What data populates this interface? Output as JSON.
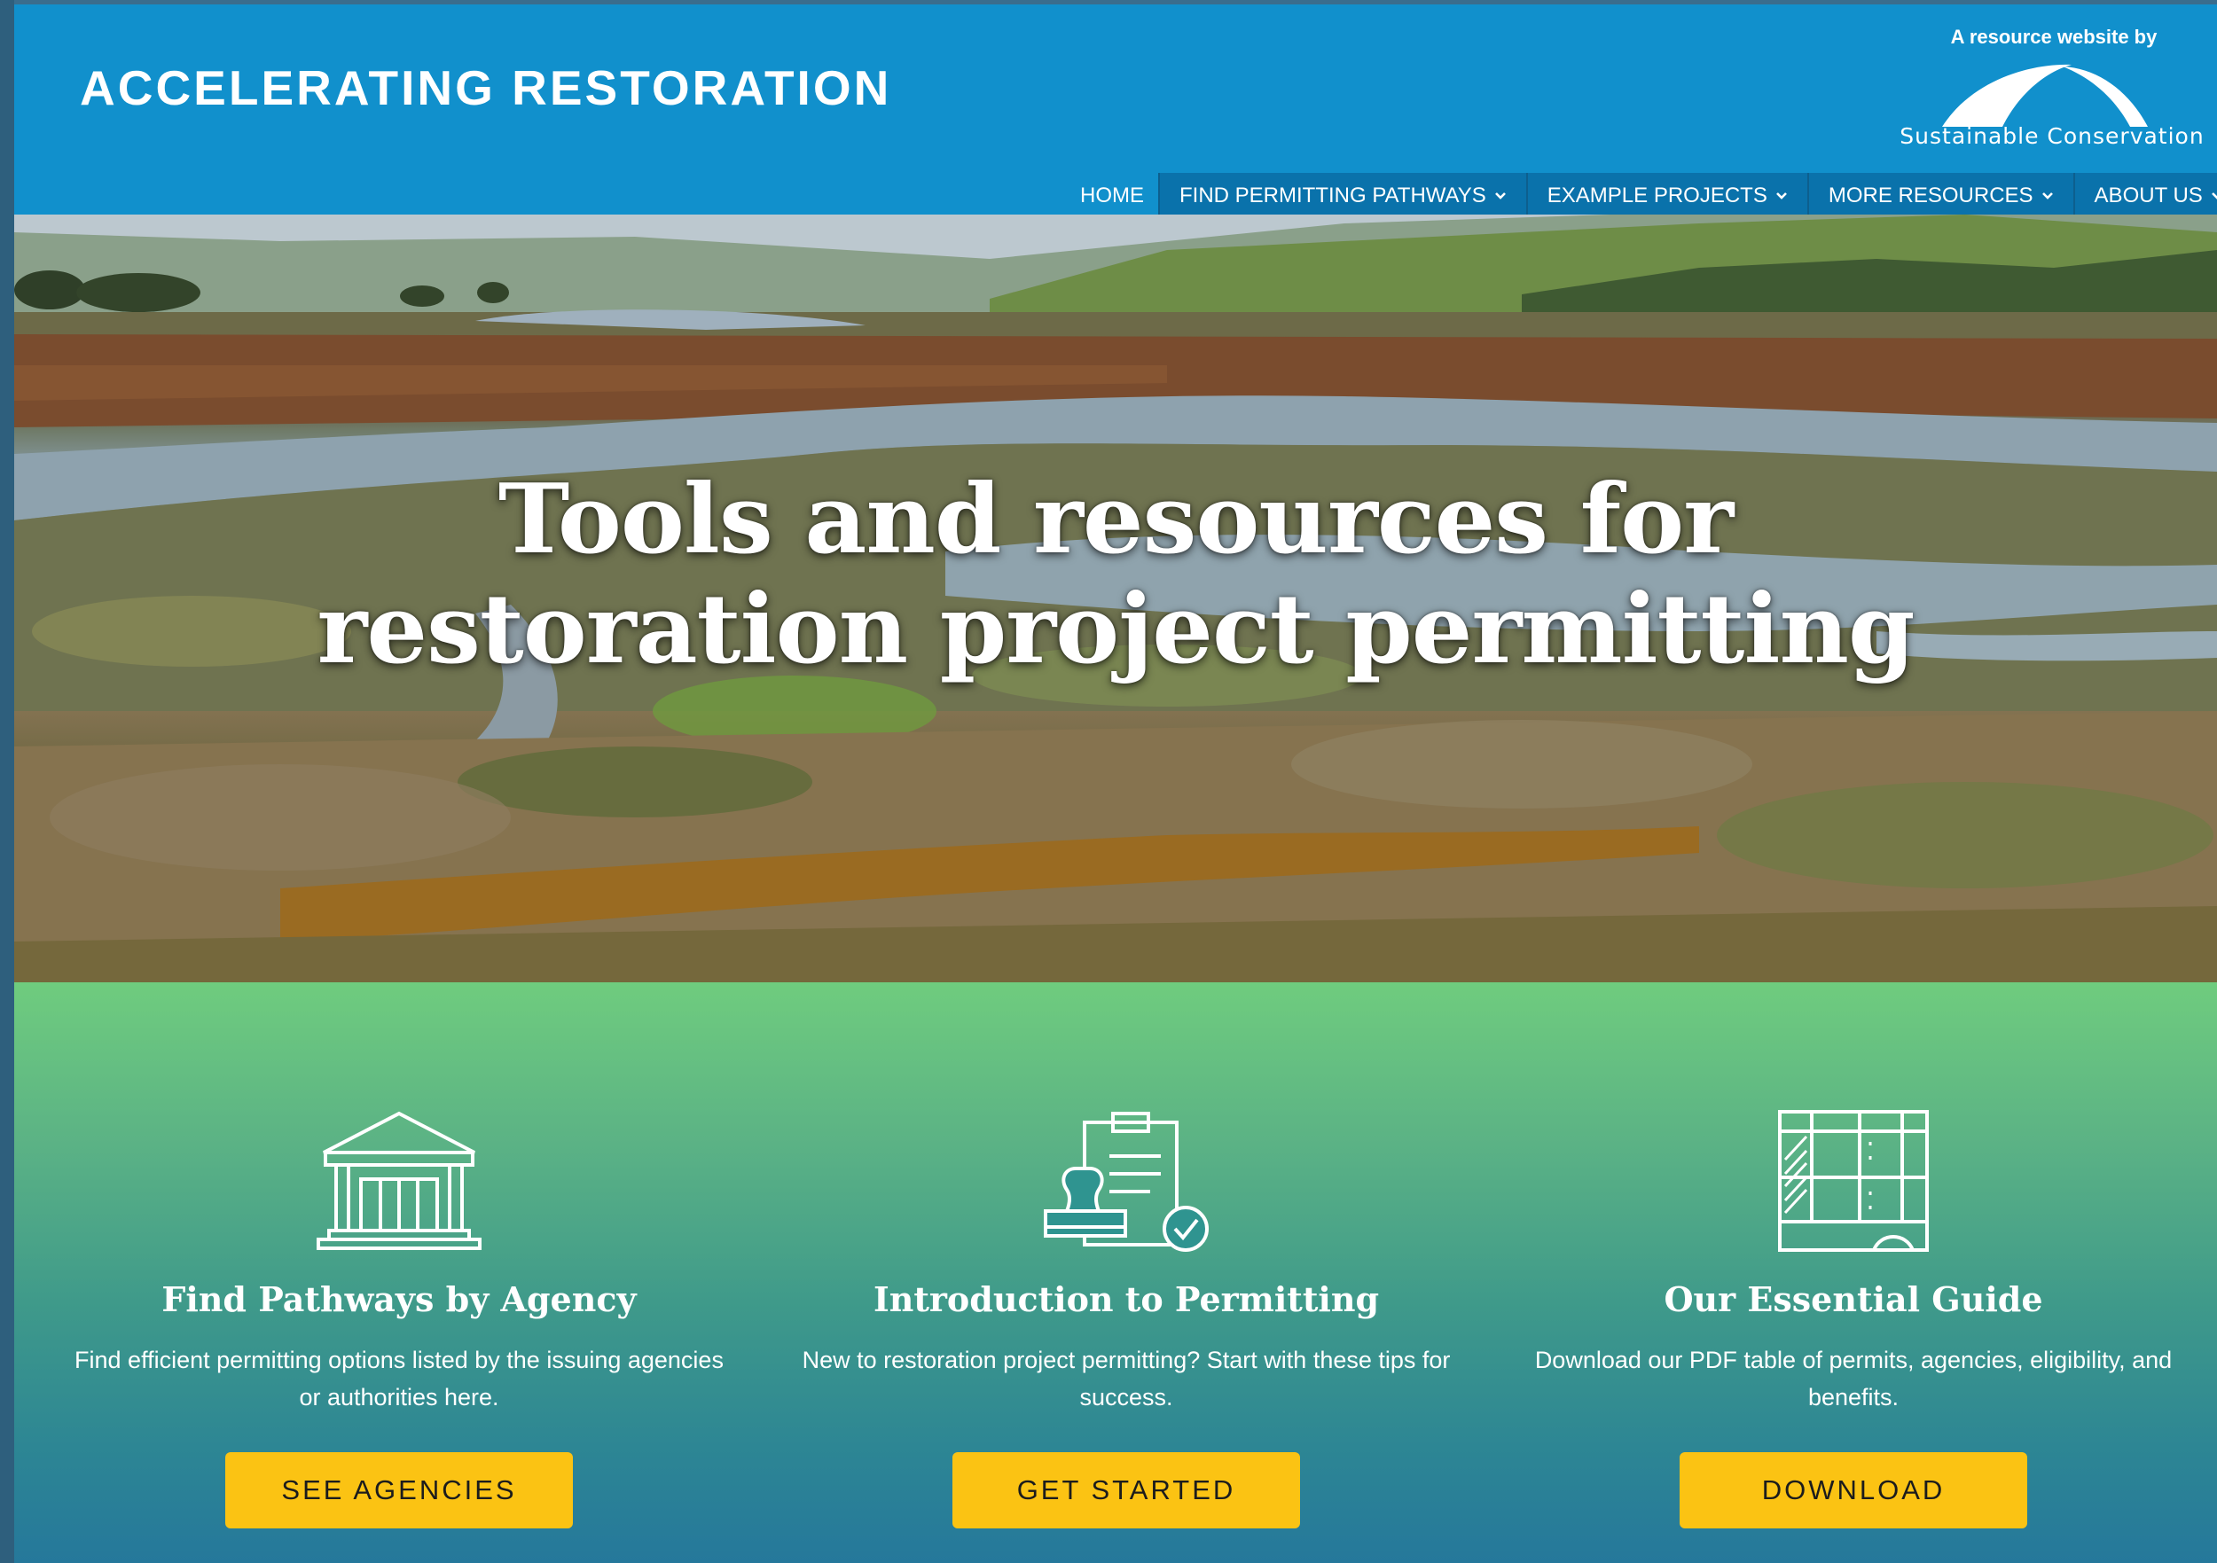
{
  "header": {
    "site_title": "ACCELERATING RESTORATION",
    "logo_tagline": "A resource website by",
    "logo_name": "Sustainable Conservation"
  },
  "nav": {
    "items": [
      {
        "label": "HOME",
        "dropdown": false
      },
      {
        "label": "FIND PERMITTING PATHWAYS",
        "dropdown": true
      },
      {
        "label": "EXAMPLE PROJECTS",
        "dropdown": true
      },
      {
        "label": "MORE RESOURCES",
        "dropdown": true
      },
      {
        "label": "ABOUT US",
        "dropdown": true
      }
    ]
  },
  "hero": {
    "title_line1": "Tools and resources for",
    "title_line2": "restoration project permitting"
  },
  "cards": [
    {
      "icon": "government-building-icon",
      "title": "Find Pathways by Agency",
      "description": "Find efficient permitting options listed by the issuing agencies or authorities here.",
      "button": "SEE AGENCIES"
    },
    {
      "icon": "permit-stamp-icon",
      "title": "Introduction to Permitting",
      "description": "New to restoration project permitting? Start with these tips for success.",
      "button": "GET STARTED"
    },
    {
      "icon": "table-guide-icon",
      "title": "Our Essential Guide",
      "description": "Download our PDF table of permits, agencies, eligibility, and benefits.",
      "button": "DOWNLOAD"
    }
  ],
  "colors": {
    "header_blue": "#1190cc",
    "nav_dark_blue": "#0a72ab",
    "button_yellow": "#fbc313",
    "gradient_top_green": "#6fcc7e",
    "gradient_bottom_blue": "#25789b"
  }
}
